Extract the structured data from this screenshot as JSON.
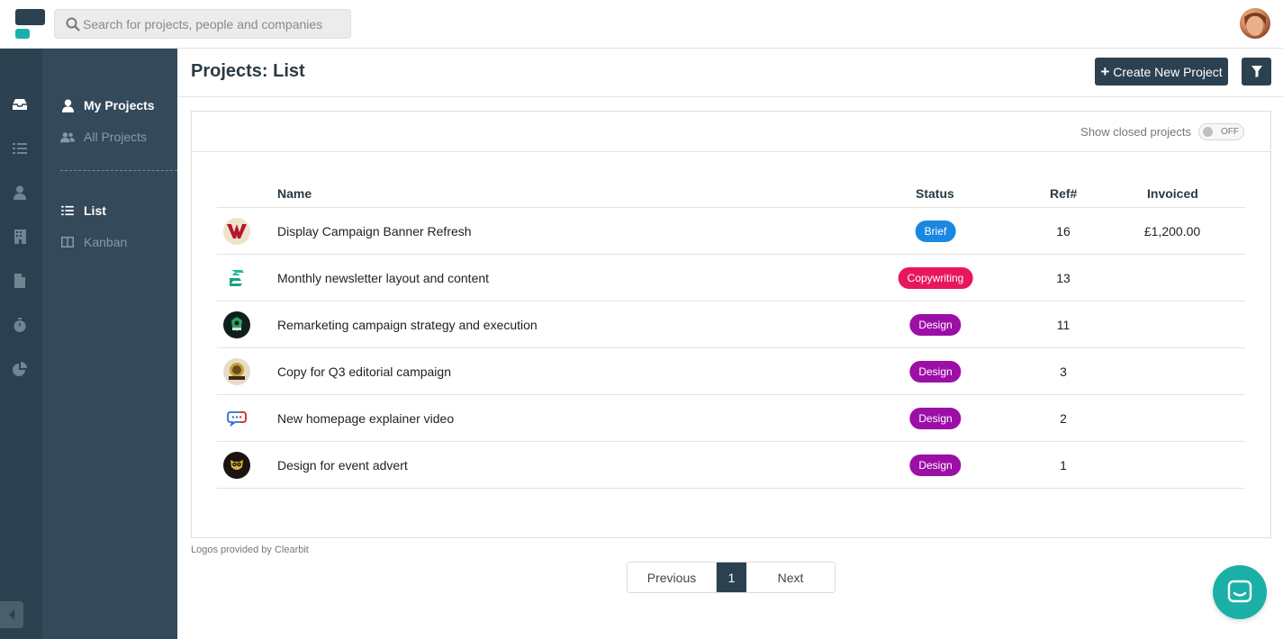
{
  "topbar": {
    "search_placeholder": "Search for projects, people and companies"
  },
  "rail": {
    "icons": [
      "inbox-icon",
      "list-icon",
      "user-icon",
      "building-icon",
      "document-icon",
      "stopwatch-icon",
      "pie-chart-icon"
    ]
  },
  "subnav": {
    "my_projects": "My Projects",
    "all_projects": "All Projects",
    "list": "List",
    "kanban": "Kanban"
  },
  "header": {
    "title": "Projects: List",
    "create_label": "Create New Project",
    "create_icon": "plus-icon",
    "filter_icon": "filter-icon"
  },
  "card": {
    "show_closed_label": "Show closed projects",
    "toggle_state": "OFF"
  },
  "table": {
    "columns": {
      "name": "Name",
      "status": "Status",
      "ref": "Ref#",
      "invoiced": "Invoiced"
    },
    "rows": [
      {
        "name": "Display Campaign Banner Refresh",
        "status": "Brief",
        "status_color": "#1a88e0",
        "ref": "16",
        "invoiced": "£1,200.00",
        "logo": "w-logo"
      },
      {
        "name": "Monthly newsletter layout and content",
        "status": "Copywriting",
        "status_color": "#e8175d",
        "ref": "13",
        "invoiced": "",
        "logo": "s-logo"
      },
      {
        "name": "Remarketing campaign strategy and execution",
        "status": "Design",
        "status_color": "#9c0fa6",
        "ref": "11",
        "invoiced": "",
        "logo": "green-badge-logo"
      },
      {
        "name": "Copy for Q3 editorial campaign",
        "status": "Design",
        "status_color": "#9c0fa6",
        "ref": "3",
        "invoiced": "",
        "logo": "brewery-logo"
      },
      {
        "name": "New homepage explainer video",
        "status": "Design",
        "status_color": "#9c0fa6",
        "ref": "2",
        "invoiced": "",
        "logo": "speech-bubble-logo"
      },
      {
        "name": "Design for event advert",
        "status": "Design",
        "status_color": "#9c0fa6",
        "ref": "1",
        "invoiced": "",
        "logo": "owl-logo"
      }
    ]
  },
  "footer": {
    "clearbit": "Logos provided by Clearbit"
  },
  "pagination": {
    "previous": "Previous",
    "current": "1",
    "next": "Next"
  },
  "colors": {
    "sidebar_dark": "#2b4150",
    "sidebar": "#34495a",
    "accent_teal": "#1bb0a7"
  }
}
